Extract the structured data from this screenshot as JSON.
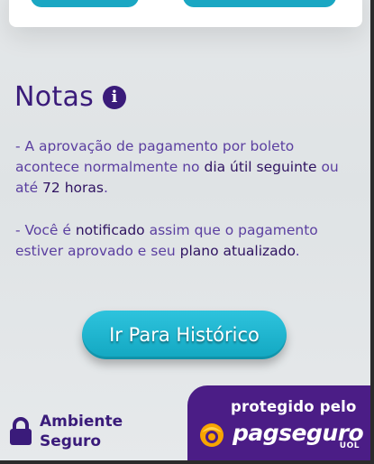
{
  "notes": {
    "title": "Notas",
    "icon": "info-icon",
    "paragraph1": {
      "prefix": "- A aprovação de pagamento por boleto acontece normalmente no ",
      "highlight1": "dia útil seguinte",
      "middle": " ou até ",
      "highlight2": "72 horas",
      "suffix": "."
    },
    "paragraph2": {
      "prefix": "- Você é ",
      "highlight1": "notificado",
      "middle": " assim que o pagamento estiver aprovado e seu ",
      "highlight2": "plano atualizado",
      "suffix": "."
    }
  },
  "actions": {
    "history_button_label": "Ir Para Histórico"
  },
  "footer": {
    "secure_line1": "Ambiente",
    "secure_line2": "Seguro",
    "badge_line": "protegido pelo",
    "brand_name": "pagseguro",
    "brand_suffix": "UOL"
  },
  "colors": {
    "primary_purple": "#3a1b7a",
    "accent_cyan": "#1aa7c3",
    "badge_purple": "#4b1d86"
  }
}
